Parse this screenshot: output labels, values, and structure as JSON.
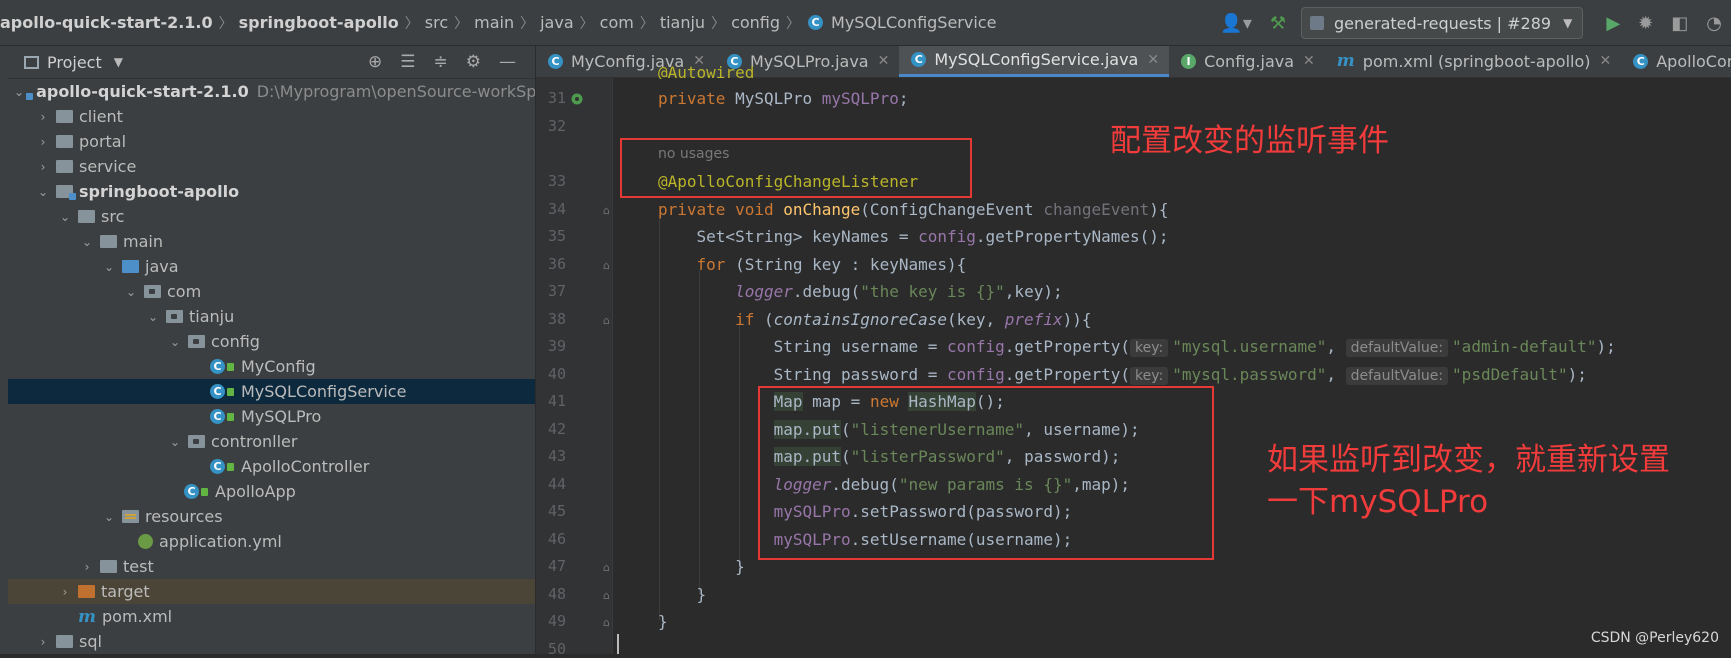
{
  "breadcrumbs": [
    "apollo-quick-start-2.1.0",
    "springboot-apollo",
    "src",
    "main",
    "java",
    "com",
    "tianju",
    "config",
    "MySQLConfigService"
  ],
  "run_config": {
    "label": "generated-requests | #289"
  },
  "project_panel": {
    "title": "Project",
    "tree": [
      {
        "label": "apollo-quick-start-2.1.0",
        "path": "D:\\Myprogram\\openSource-workSpace"
      },
      {
        "label": "client"
      },
      {
        "label": "portal"
      },
      {
        "label": "service"
      },
      {
        "label": "springboot-apollo"
      },
      {
        "label": "src"
      },
      {
        "label": "main"
      },
      {
        "label": "java"
      },
      {
        "label": "com"
      },
      {
        "label": "tianju"
      },
      {
        "label": "config"
      },
      {
        "label": "MyConfig"
      },
      {
        "label": "MySQLConfigService"
      },
      {
        "label": "MySQLPro"
      },
      {
        "label": "contronller"
      },
      {
        "label": "ApolloController"
      },
      {
        "label": "ApolloApp"
      },
      {
        "label": "resources"
      },
      {
        "label": "application.yml"
      },
      {
        "label": "test"
      },
      {
        "label": "target"
      },
      {
        "label": "pom.xml"
      },
      {
        "label": "sql"
      }
    ]
  },
  "tabs": [
    {
      "label": "MyConfig.java"
    },
    {
      "label": "MySQLPro.java"
    },
    {
      "label": "MySQLConfigService.java"
    },
    {
      "label": "Config.java"
    },
    {
      "label": "pom.xml (springboot-apollo)"
    },
    {
      "label": "ApolloController.jav"
    }
  ],
  "line_numbers": [
    "31",
    "32",
    "33",
    "34",
    "35",
    "36",
    "37",
    "38",
    "39",
    "40",
    "41",
    "42",
    "43",
    "44",
    "45",
    "46",
    "47",
    "48",
    "49",
    "50"
  ],
  "code": {
    "no_usages": "no usages",
    "hint_key": "key:",
    "hint_default": "defaultValue:"
  },
  "annotations": {
    "listener_note": "配置改变的监听事件",
    "reset_note_line1": "如果监听到改变，就重新设置",
    "reset_note_line2": "一下mySQLPro"
  },
  "watermark": "CSDN @Perley620",
  "colors": {
    "annotation_red": "#e53935",
    "selected_row": "#0d293e",
    "active_tab_underline": "#4a88c7"
  }
}
